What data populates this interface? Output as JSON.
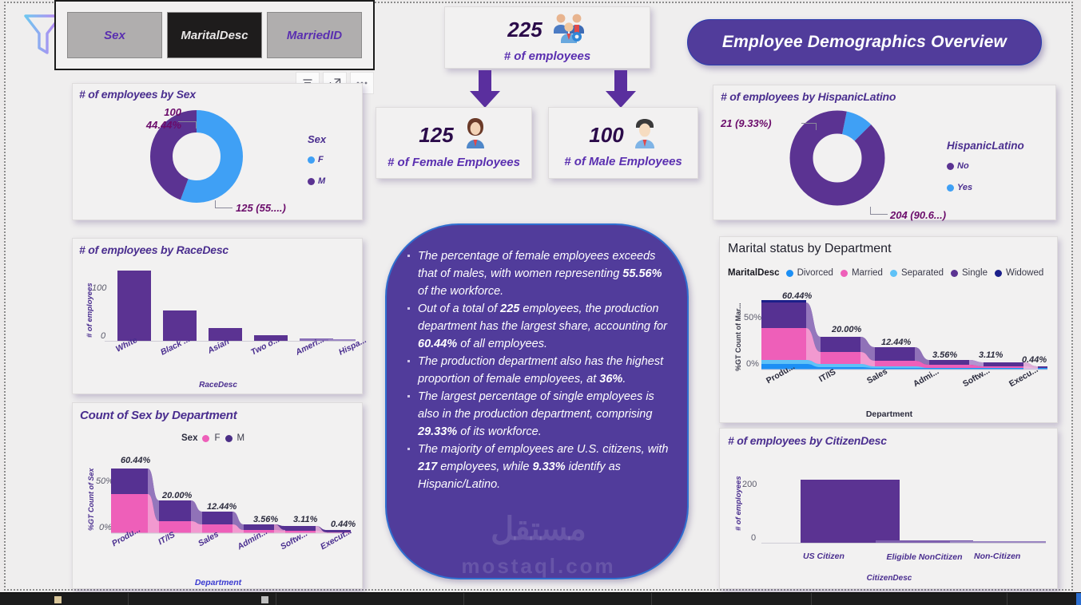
{
  "app": {
    "background_color": "#efeeee",
    "accent_purple": "#513c9b",
    "accent_blue": "#3FA0F5",
    "accent_pink": "#E85FB8"
  },
  "slicer": {
    "name": "field-slicer",
    "funnel_icon": "funnel-icon",
    "buttons": [
      {
        "label": "Sex",
        "selected": false
      },
      {
        "label": "MaritalDesc",
        "selected": true
      },
      {
        "label": "MarriedID",
        "selected": false
      }
    ]
  },
  "viz_tools": {
    "filter_icon": "filter-icon",
    "focus_icon": "focus-mode-icon",
    "more_icon": "more-options-icon"
  },
  "header": {
    "title": "Employee Demographics Overview"
  },
  "kpis": [
    {
      "name": "total-employees",
      "value": "225",
      "label": "# of employees",
      "icon": "people-group-icon"
    },
    {
      "name": "female-employees",
      "value": "125",
      "label": "# of Female Employees",
      "icon": "woman-icon"
    },
    {
      "name": "male-employees",
      "value": "100",
      "label": "# of Male Employees",
      "icon": "man-icon"
    }
  ],
  "insights": [
    "The percentage of female employees exceeds that of males, with women representing <b>55.56%</b> of the workforce.",
    "Out of a total of <b>225</b> employees, the production department has the largest share, accounting for <b>60.44%</b> of all employees.",
    "The production department also has the highest proportion of female employees, at <b>36%</b>.",
    "The largest percentage of single employees is also in the production department, comprising <b>29.33%</b> of its workforce.",
    "The majority of employees are U.S. citizens, with <b>217</b> employees, while <b>9.33%</b> identify as Hispanic/Latino."
  ],
  "watermark": {
    "main": "مستقل",
    "sub": "mostaql.com"
  },
  "chart_data": [
    {
      "id": "sex-donut",
      "type": "pie",
      "title": "# of employees by Sex",
      "legend_title": "Sex",
      "legend_position": "right",
      "categories": [
        "F",
        "M"
      ],
      "values": [
        125,
        100
      ],
      "percents": [
        "55....",
        "44.44%"
      ],
      "labels": [
        "125 (55....)",
        "100 (44.44%)"
      ],
      "colors": [
        "#3FA0F5",
        "#5B3392"
      ]
    },
    {
      "id": "hispanic-donut",
      "type": "pie",
      "title": "# of employees by HispanicLatino",
      "legend_title": "HispanicLatino",
      "legend_position": "right",
      "categories": [
        "No",
        "Yes"
      ],
      "values": [
        204,
        21
      ],
      "labels": [
        "204 (90.6...)",
        "21 (9.33%)"
      ],
      "colors": [
        "#5B3392",
        "#3FA0F5"
      ]
    },
    {
      "id": "racedesc-bar",
      "type": "bar",
      "title": "# of employees by RaceDesc",
      "xlabel": "RaceDesc",
      "ylabel": "# of employees",
      "categories": [
        "White",
        "Black ...",
        "Asian",
        "Two o...",
        "Ameri...",
        "Hispa..."
      ],
      "values": [
        134,
        58,
        25,
        10,
        3,
        2
      ],
      "yticks": [
        "0",
        "100"
      ],
      "ylim": [
        0,
        150
      ],
      "color": "#5B3392",
      "grid": false
    },
    {
      "id": "sex-by-department-ribbon",
      "type": "area",
      "title": "Count of Sex by Department",
      "xlabel": "Department",
      "ylabel": "%GT Count of Sex",
      "legend_title": "Sex",
      "legend_position": "top",
      "categories": [
        "Produ...",
        "IT/IS",
        "Sales",
        "Admin...",
        "Softw...",
        "Execut..."
      ],
      "totals_labels": [
        "60.44%",
        "20.00%",
        "12.44%",
        "3.56%",
        "3.11%",
        "0.44%"
      ],
      "totals": [
        60.44,
        20.0,
        12.44,
        3.56,
        3.11,
        0.44
      ],
      "series": [
        {
          "name": "F",
          "color": "#EE5FB9",
          "values": [
            36.0,
            8.5,
            7.2,
            2.1,
            1.8,
            0.3
          ]
        },
        {
          "name": "M",
          "color": "#5B3392",
          "values": [
            24.44,
            11.5,
            5.24,
            1.46,
            1.31,
            0.14
          ]
        }
      ],
      "yticks": [
        "0%",
        "50%"
      ],
      "ylim": [
        0,
        65
      ]
    },
    {
      "id": "marital-by-department-ribbon",
      "type": "area",
      "title": "Marital status by Department",
      "xlabel": "Department",
      "ylabel": "%GT Count of Mar...",
      "legend_title": "MaritalDesc",
      "legend_position": "top",
      "categories": [
        "Produ...",
        "IT/IS",
        "Sales",
        "Admi...",
        "Softw...",
        "Execu..."
      ],
      "totals_labels": [
        "60.44%",
        "20.00%",
        "12.44%",
        "3.56%",
        "3.11%",
        "0.44%"
      ],
      "totals": [
        60.44,
        20.0,
        12.44,
        3.56,
        3.11,
        0.44
      ],
      "series": [
        {
          "name": "Divorced",
          "color": "#1C8FF5",
          "values": [
            4.0,
            1.2,
            0.8,
            0.2,
            0.2,
            0.05
          ]
        },
        {
          "name": "Married",
          "color": "#EE5FB9",
          "values": [
            18.0,
            6.0,
            4.2,
            1.0,
            0.9,
            0.12
          ]
        },
        {
          "name": "Separated",
          "color": "#5FC2F7",
          "values": [
            3.0,
            0.8,
            0.6,
            0.2,
            0.15,
            0.03
          ]
        },
        {
          "name": "Single",
          "color": "#5B3392",
          "values": [
            29.33,
            11.0,
            6.0,
            1.9,
            1.7,
            0.2
          ]
        },
        {
          "name": "Widowed",
          "color": "#1B1F8A",
          "values": [
            6.11,
            1.0,
            0.84,
            0.26,
            0.16,
            0.04
          ]
        }
      ],
      "yticks": [
        "0%",
        "50%"
      ],
      "ylim": [
        0,
        65
      ]
    },
    {
      "id": "citizendesc-bar",
      "type": "bar",
      "title": "# of employees by CitizenDesc",
      "xlabel": "CitizenDesc",
      "ylabel": "# of employees",
      "categories": [
        "US Citizen",
        "Eligible NonCitizen",
        "Non-Citizen"
      ],
      "values": [
        217,
        5,
        3
      ],
      "yticks": [
        "0",
        "200"
      ],
      "ylim": [
        0,
        230
      ],
      "color": "#5B3392",
      "grid": false
    }
  ]
}
